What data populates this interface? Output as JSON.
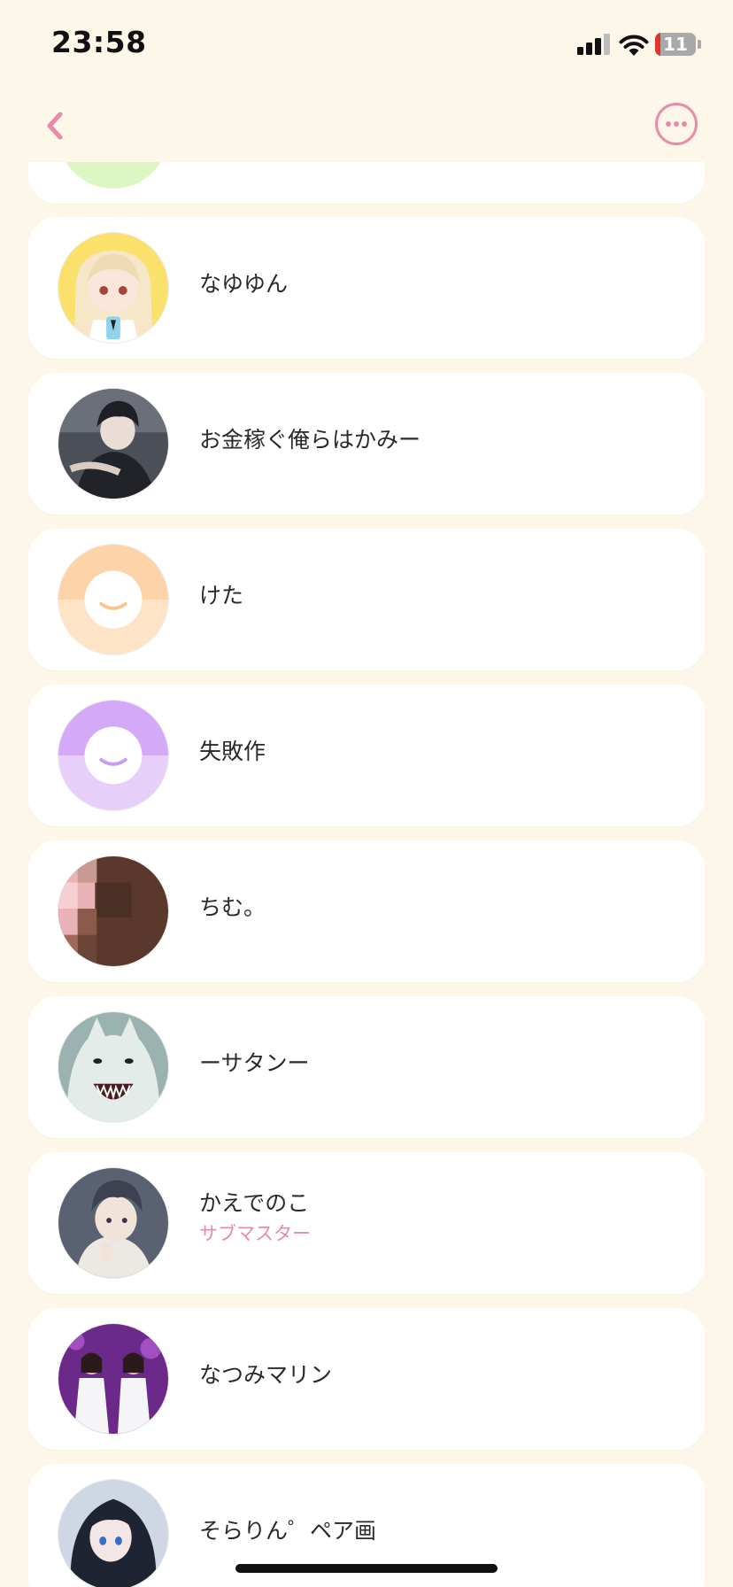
{
  "status_bar": {
    "time": "23:58",
    "battery_level": "11",
    "icons": [
      "cellular-signal-icon",
      "wifi-icon",
      "battery-icon"
    ]
  },
  "nav": {
    "back_icon": "chevron-left-icon",
    "more_icon": "ellipsis-circle-icon",
    "accent_color": "#e98aa8"
  },
  "members": [
    {
      "name": "なゆゆん",
      "role": "",
      "avatar": "anime-girl-blonde"
    },
    {
      "name": "お金稼ぐ俺らはかみー",
      "role": "",
      "avatar": "anime-boy-dark"
    },
    {
      "name": "けた",
      "role": "",
      "avatar": "default-smile-orange"
    },
    {
      "name": "失敗作",
      "role": "",
      "avatar": "default-smile-purple"
    },
    {
      "name": "ちむ。",
      "role": "",
      "avatar": "pixelated-photo"
    },
    {
      "name": "ーサタンー",
      "role": "",
      "avatar": "white-wolf"
    },
    {
      "name": "かえでのこ",
      "role": "サブマスター",
      "avatar": "anime-boy-hoodie"
    },
    {
      "name": "なつみマリン",
      "role": "",
      "avatar": "concert-photo"
    },
    {
      "name": "そらりん゜ペア画",
      "role": "",
      "avatar": "anime-girl-darkhair"
    }
  ],
  "colors": {
    "background": "#fdf7ea",
    "card": "#ffffff",
    "role_text": "#e98aa8"
  }
}
